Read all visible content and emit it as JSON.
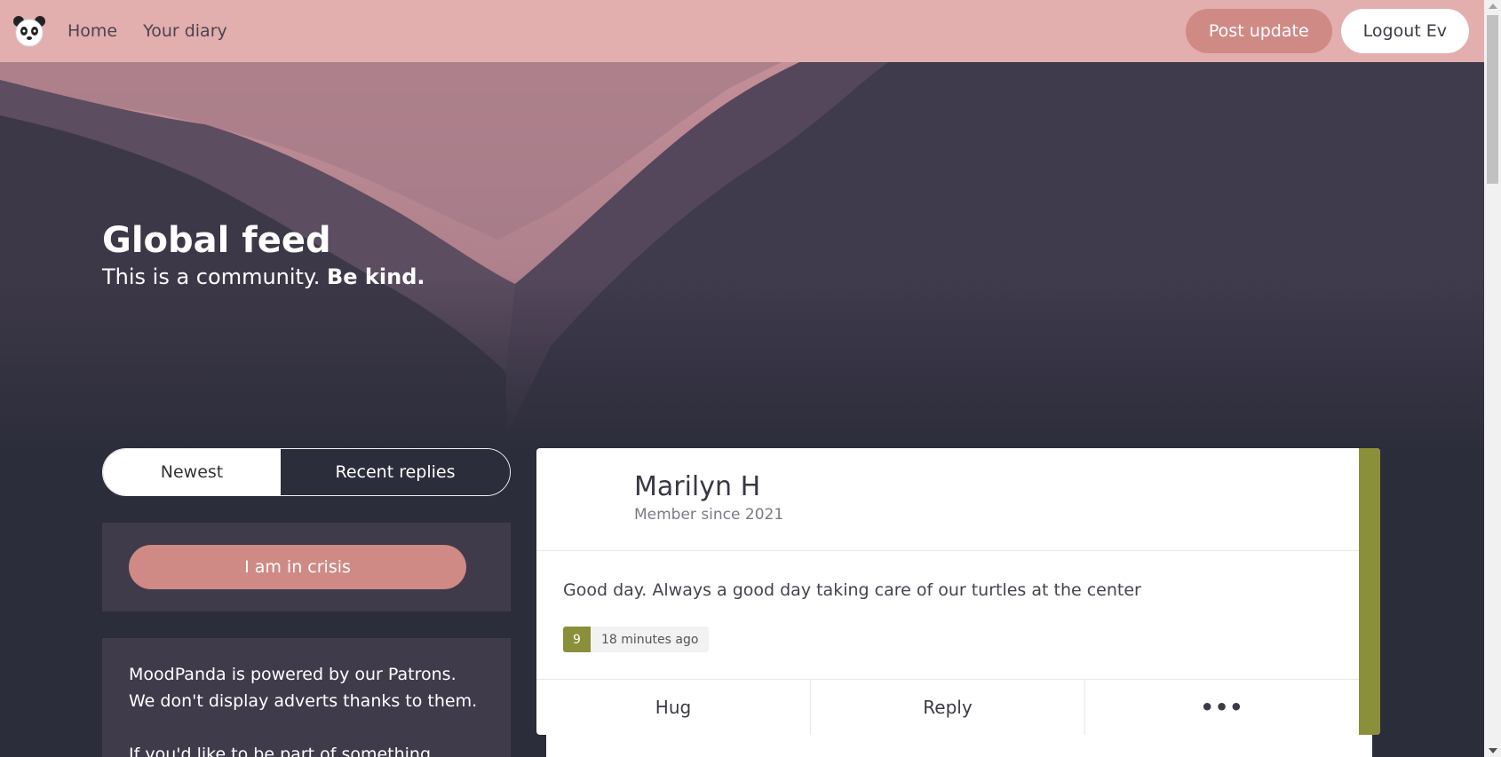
{
  "nav": {
    "logo_icon": "panda-logo-icon",
    "links": [
      "Home",
      "Your diary"
    ],
    "post_label": "Post update",
    "logout_label": "Logout Ev"
  },
  "hero": {
    "title": "Global feed",
    "subtitle_plain": "This is a community.",
    "subtitle_bold": "Be kind."
  },
  "tabs": {
    "newest": "Newest",
    "recent_replies": "Recent replies",
    "active": "Newest"
  },
  "crisis": {
    "label": "I am in crisis"
  },
  "patron": {
    "line1": "MoodPanda is powered by our Patrons. We don't display adverts thanks to them.",
    "line2": "If you'd like to be part of something"
  },
  "feed": {
    "posts": [
      {
        "name": "Marilyn H",
        "member_since": "Member since 2021",
        "body": "Good day. Always a good day taking care of our turtles at the center",
        "mood": "9",
        "time": "18 minutes ago",
        "actions": {
          "hug": "Hug",
          "reply": "Reply",
          "more": "•••"
        }
      }
    ]
  },
  "colors": {
    "navbar": "#e3aeae",
    "accent_button": "#cf8a86",
    "mood_green": "#8a8f3a",
    "page_bg": "#2c2d3b",
    "panel_bg": "#3f3b4b"
  }
}
